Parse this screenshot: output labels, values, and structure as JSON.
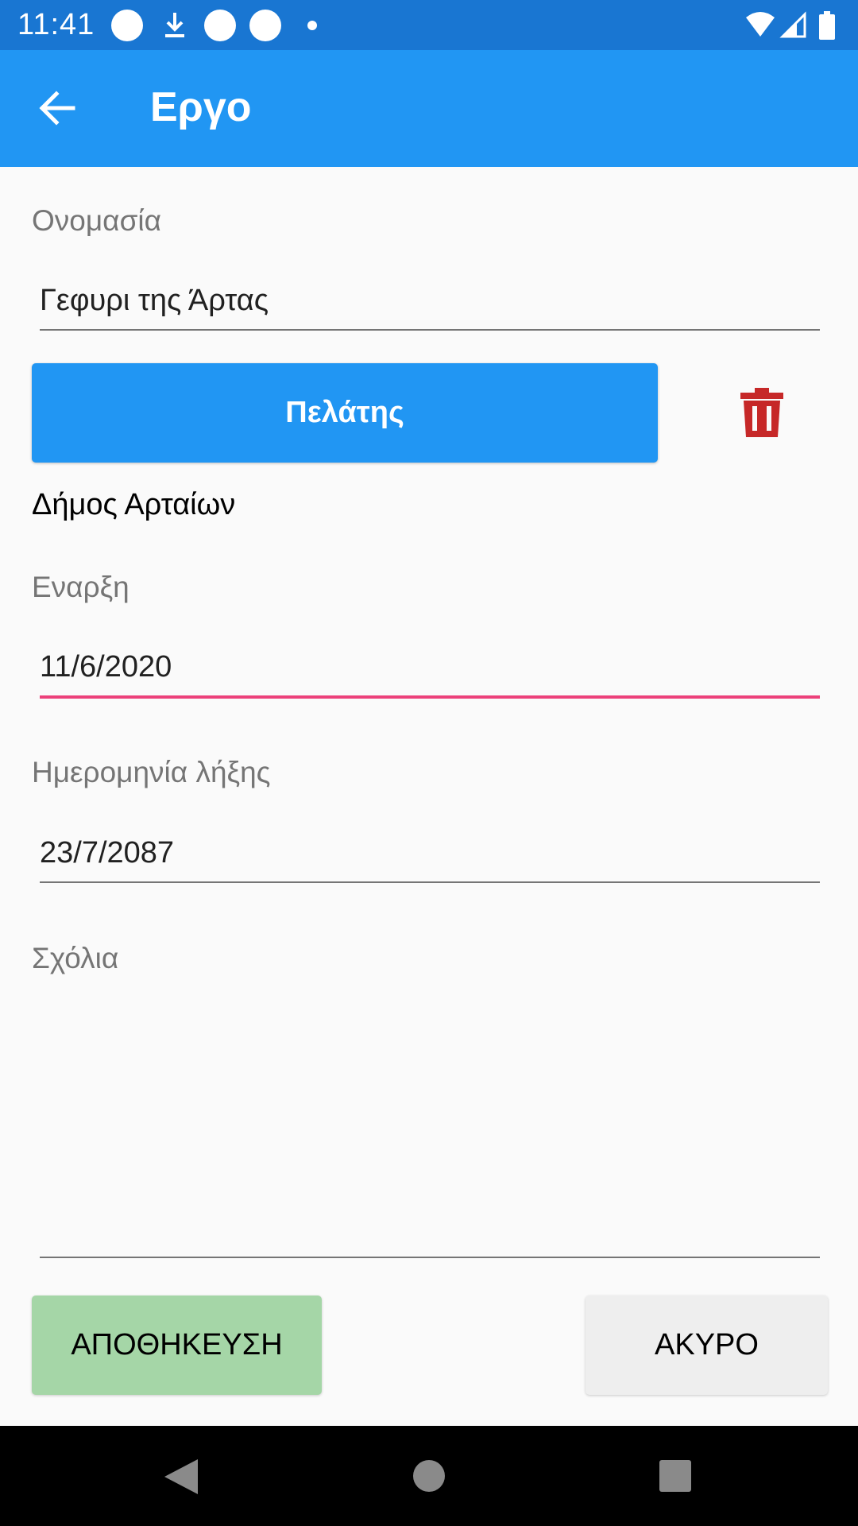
{
  "status_bar": {
    "time": "11:41"
  },
  "app_bar": {
    "title": "Εργο"
  },
  "form": {
    "name_label": "Ονομασία",
    "name_value": "Γεφυρι της Άρτας",
    "customer_button_label": "Πελάτης",
    "customer_name": "Δήμος Αρταίων",
    "start_label": "Εναρξη",
    "start_value": "11/6/2020",
    "end_label": "Ημερομηνία λήξης",
    "end_value": "23/7/2087",
    "notes_label": "Σχόλια",
    "notes_value": ""
  },
  "actions": {
    "save_label": "ΑΠΟΘΗΚΕΥΣΗ",
    "cancel_label": "ΑΚΥΡΟ"
  },
  "colors": {
    "status_bar": "#1976d2",
    "app_bar": "#2196f3",
    "focus_underline": "#ec407a",
    "delete_icon": "#c62828",
    "save_button": "#a5d6a7",
    "cancel_button": "#eeeeee"
  },
  "icons": [
    "back-arrow-icon",
    "trash-icon",
    "download-icon",
    "wifi-icon",
    "signal-icon",
    "battery-icon",
    "nav-back-icon",
    "nav-home-icon",
    "nav-recents-icon"
  ]
}
